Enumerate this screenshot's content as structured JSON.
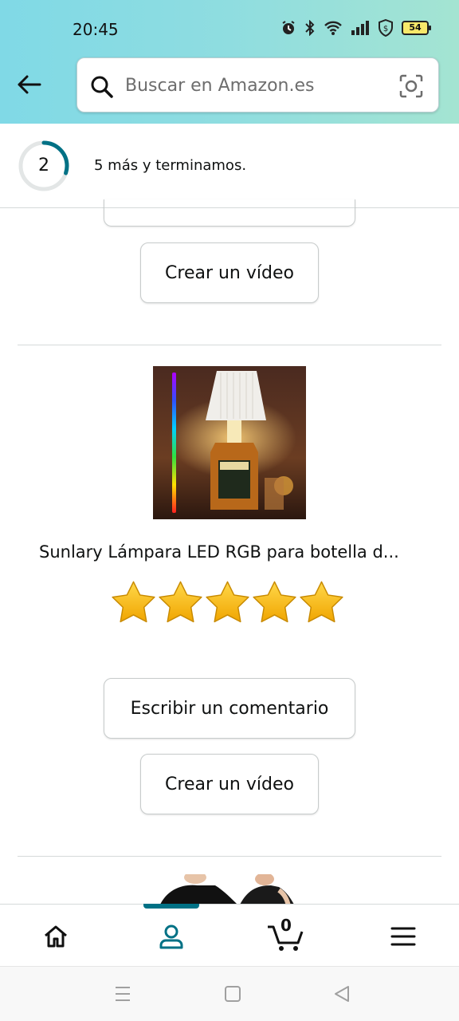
{
  "status_bar": {
    "time": "20:45",
    "battery": "54"
  },
  "header": {
    "back_icon": "arrow-left-icon",
    "search": {
      "placeholder": "Buscar en Amazon.es"
    },
    "camera_icon": "camera-scan-icon"
  },
  "progress": {
    "current": "2",
    "message": "5 más y terminamos.",
    "fraction": 0.3
  },
  "cards": [
    {
      "video_label": "Crear un vídeo"
    },
    {
      "title": "Sunlary Lámpara LED RGB para botella d...",
      "rating": 5,
      "max_rating": 5,
      "review_label": "Escribir un comentario",
      "video_label": "Crear un vídeo"
    }
  ],
  "bottom_nav": {
    "items": [
      "home-icon",
      "account-icon",
      "cart-icon",
      "menu-icon"
    ],
    "cart_count": "0",
    "active": "account"
  },
  "colors": {
    "header_gradient_start": "#80d9e6",
    "header_gradient_end": "#a4e4d2",
    "accent": "#007185",
    "star": "#f7b500"
  }
}
